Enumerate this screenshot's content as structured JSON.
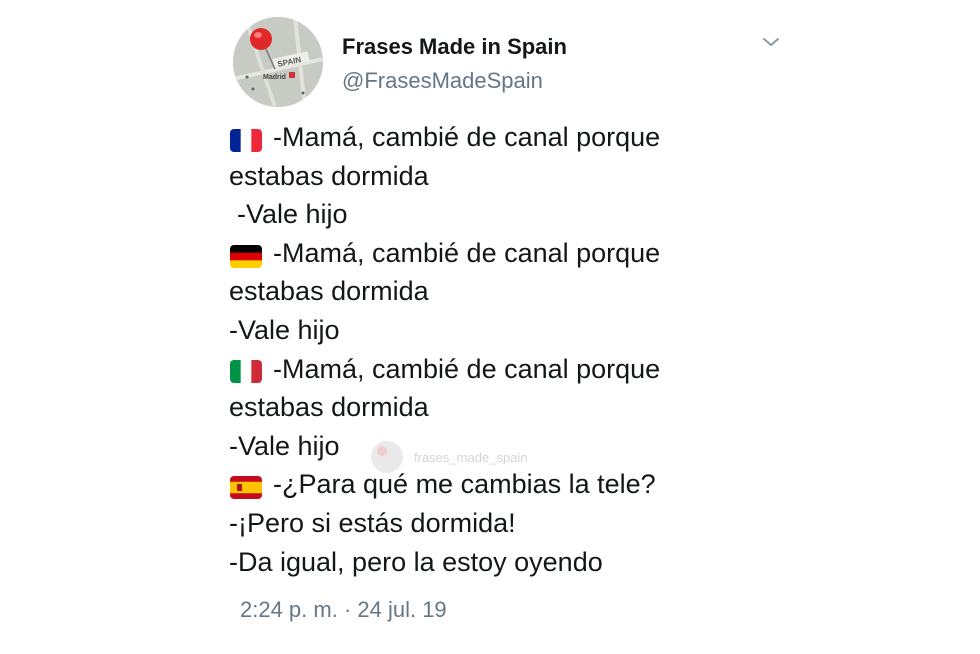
{
  "account": {
    "display_name": "Frases Made in Spain",
    "handle": "@FrasesMadeSpain",
    "avatar_label": "SPAIN",
    "avatar_city": "Madrid"
  },
  "tweet": {
    "lines": [
      {
        "flag": "france-flag-icon",
        "text": "-Mamá, cambié de canal porque"
      },
      {
        "flag": null,
        "text": "estabas dormida"
      },
      {
        "flag": null,
        "text": "-Vale hijo",
        "indent": true
      },
      {
        "flag": "germany-flag-icon",
        "text": "-Mamá, cambié de canal porque"
      },
      {
        "flag": null,
        "text": "estabas dormida"
      },
      {
        "flag": null,
        "text": "-Vale hijo"
      },
      {
        "flag": "italy-flag-icon",
        "text": "-Mamá, cambié de canal porque"
      },
      {
        "flag": null,
        "text": "estabas dormida"
      },
      {
        "flag": null,
        "text": "-Vale hijo"
      },
      {
        "flag": "spain-flag-icon",
        "text": "-¿Para qué me cambias la tele?"
      },
      {
        "flag": null,
        "text": "-¡Pero si estás dormida!"
      },
      {
        "flag": null,
        "text": "-Da igual, pero la estoy oyendo"
      }
    ],
    "watermark": "frases_made_spain",
    "timestamp": "2:24 p. m. · 24 jul. 19"
  },
  "icons": {
    "menu": "chevron-down-icon",
    "pin": "map-pin-icon"
  },
  "colors": {
    "text": "#14171a",
    "secondary": "#657786",
    "france": [
      "#002395",
      "#ffffff",
      "#ed2939"
    ],
    "germany": [
      "#000000",
      "#dd0000",
      "#ffce00"
    ],
    "italy": [
      "#009246",
      "#ffffff",
      "#ce2b37"
    ],
    "spain": [
      "#c60b1e",
      "#ffc400",
      "#c60b1e"
    ]
  }
}
